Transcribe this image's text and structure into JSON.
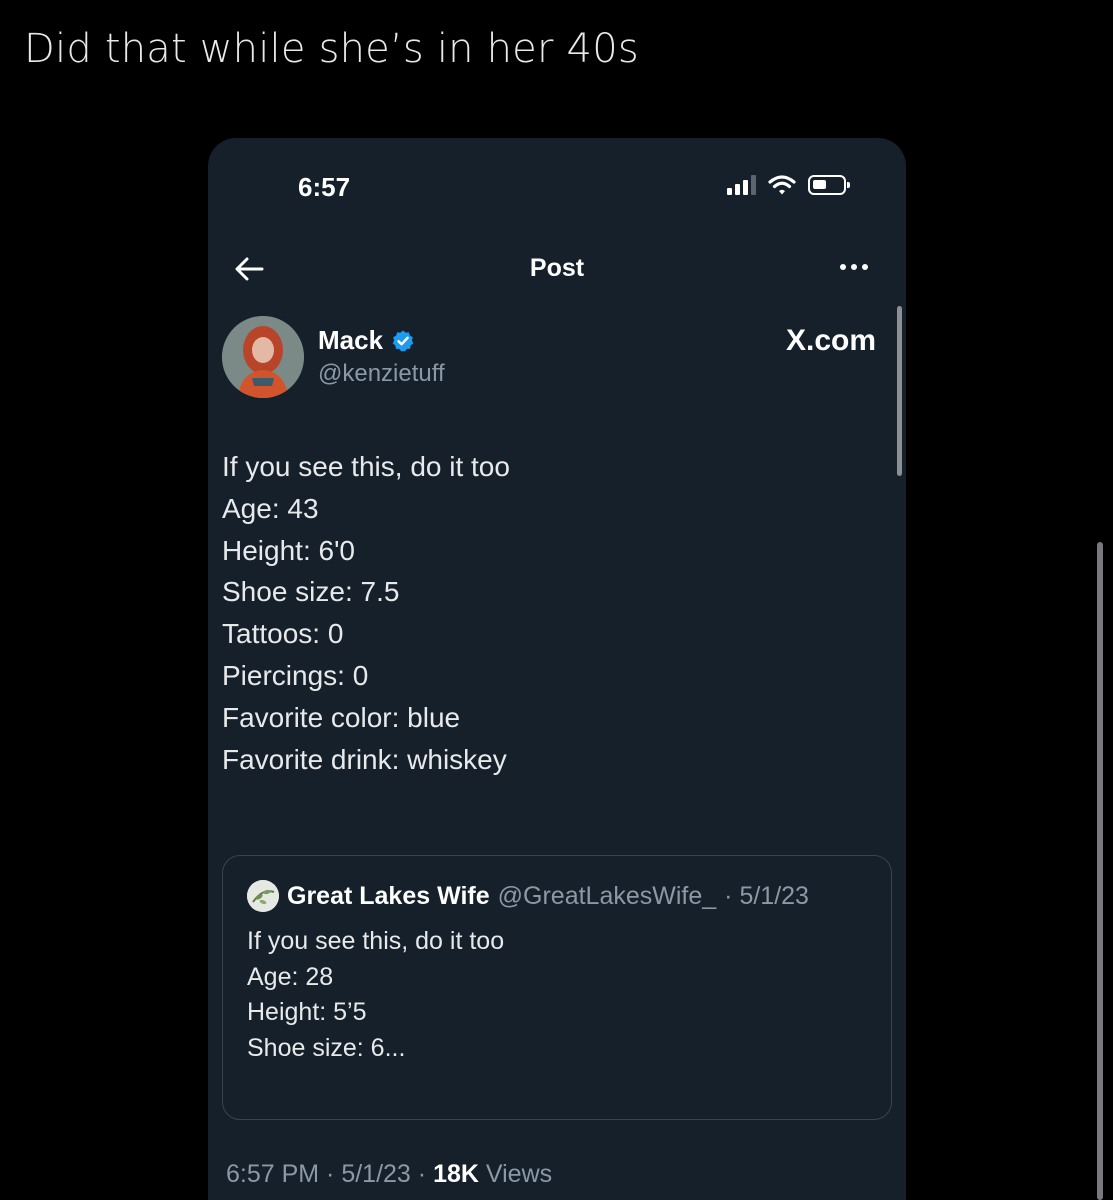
{
  "caption": "Did that while she’s in her 40s",
  "status_bar": {
    "time": "6:57"
  },
  "nav": {
    "title": "Post"
  },
  "author": {
    "name": "Mack",
    "handle": "@kenzietuff"
  },
  "watermark": "X.com",
  "post": {
    "intro": "If you see this, do it too",
    "lines": [
      "Age: 43",
      "Height: 6'0",
      "Shoe size: 7.5",
      "Tattoos: 0",
      "Piercings: 0",
      "Favorite color: blue",
      "Favorite drink: whiskey"
    ]
  },
  "quoted_post": {
    "name": "Great Lakes Wife",
    "handle": "@GreatLakesWife_",
    "date": "· 5/1/23",
    "intro": "If you see this, do it too",
    "lines": [
      "Age: 28",
      "Height: 5’5",
      "Shoe size: 6..."
    ]
  },
  "meta": {
    "time": "6:57 PM",
    "sep1": " · ",
    "date": "5/1/23",
    "sep2": " · ",
    "views_count": "18K",
    "views_label": " Views"
  },
  "colors": {
    "background": "#000000",
    "panel": "#15202b",
    "text": "#e7e9ea",
    "muted": "#8b98a5",
    "verified": "#1d9bf0"
  },
  "icons": {
    "back": "arrow-left-icon",
    "more": "more-horizontal-icon",
    "verified": "verified-badge-icon",
    "signal": "cellular-signal-icon",
    "wifi": "wifi-icon",
    "battery": "battery-icon"
  }
}
